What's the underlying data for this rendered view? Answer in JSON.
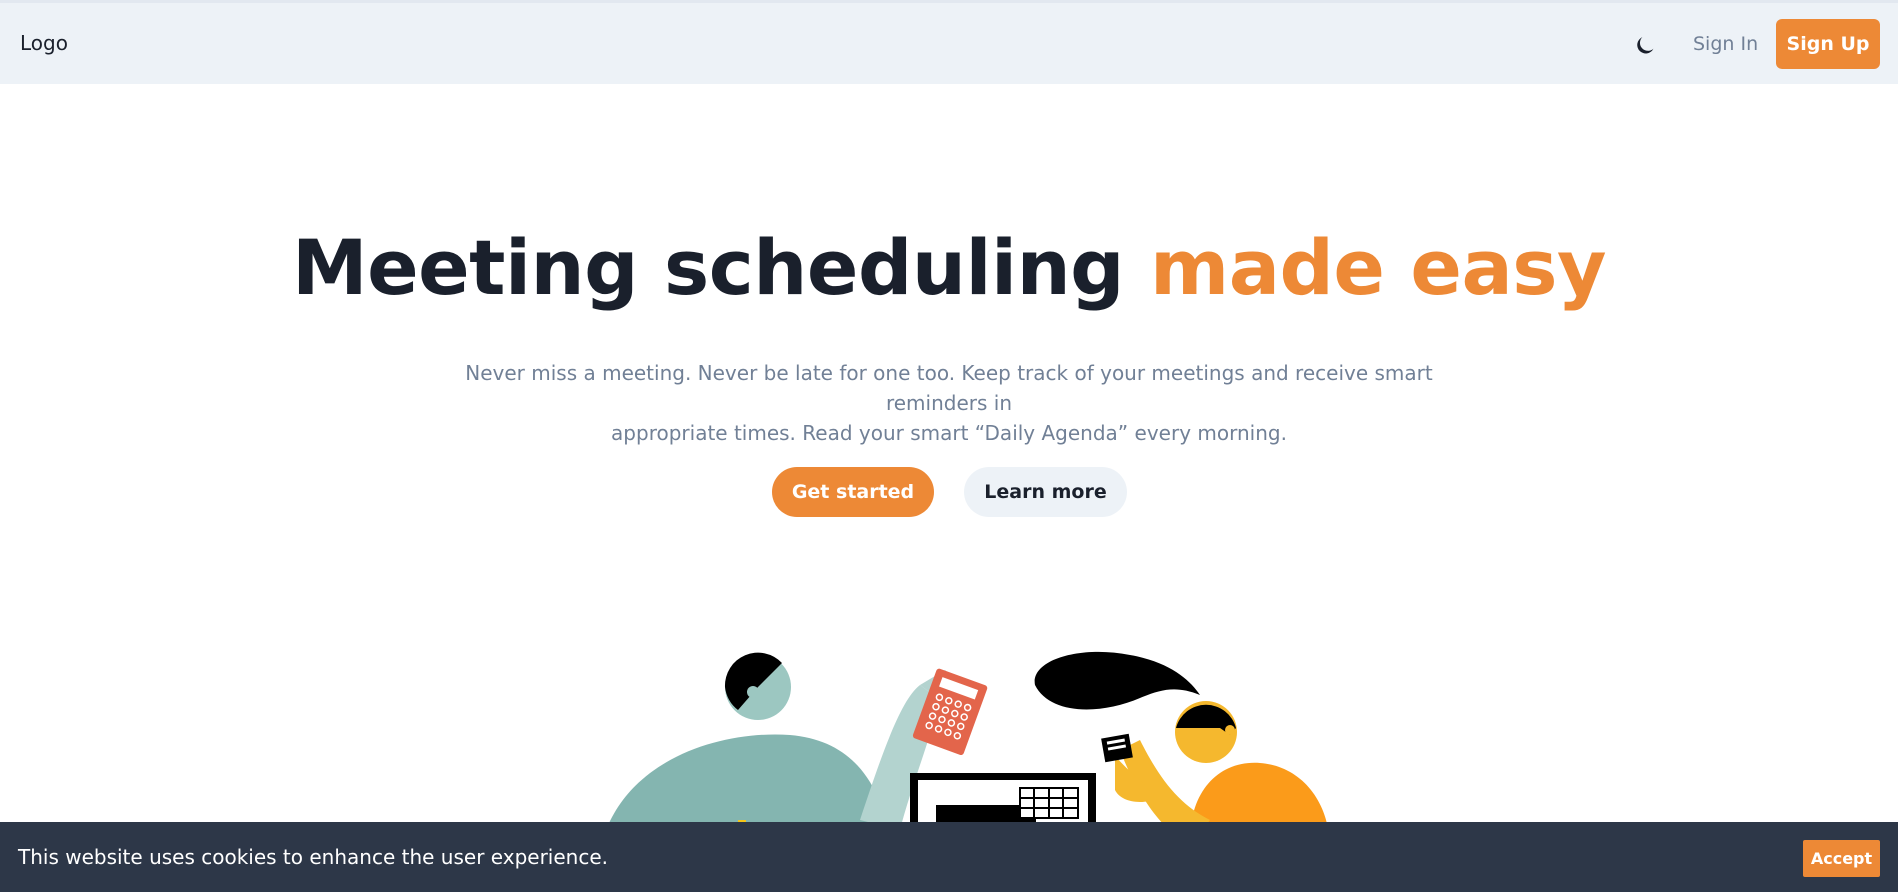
{
  "header": {
    "logo": "Logo",
    "theme_toggle_icon": "moon-icon",
    "sign_in": "Sign In",
    "sign_up": "Sign Up"
  },
  "hero": {
    "title_main": "Meeting scheduling",
    "title_accent": "made easy",
    "subtitle_line1": "Never miss a meeting. Never be late for one too. Keep track of your meetings and receive smart reminders in",
    "subtitle_line2": "appropriate times. Read your smart “Daily Agenda” every morning.",
    "primary_cta": "Get started",
    "secondary_cta": "Learn more"
  },
  "cookie_banner": {
    "message": "This website uses cookies to enhance the user experience.",
    "accept": "Accept"
  },
  "colors": {
    "accent": "#ed8936",
    "header_bg": "#edf2f7",
    "dark": "#1a202c",
    "muted": "#718096",
    "banner_bg": "#2d3748"
  }
}
